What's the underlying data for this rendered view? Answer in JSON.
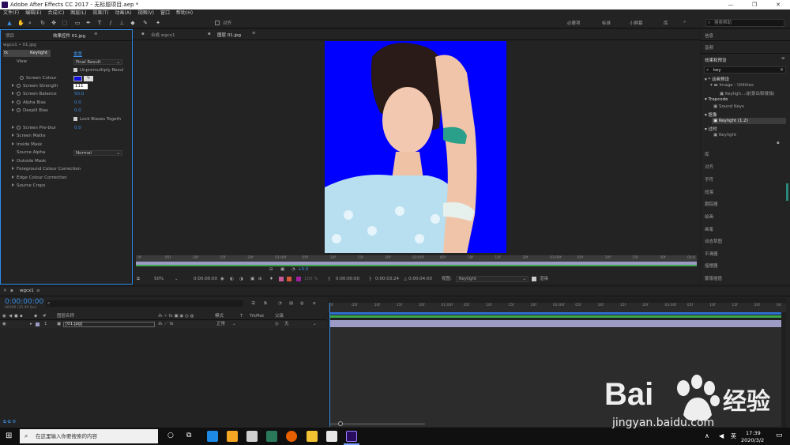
{
  "window": {
    "title": "Adobe After Effects CC 2017 - 无标题项目.aep *"
  },
  "menu": [
    "文件(F)",
    "编辑(E)",
    "合成(C)",
    "图层(L)",
    "效果(T)",
    "动画(A)",
    "视图(V)",
    "窗口",
    "帮助(H)"
  ],
  "toolbar": {
    "align_label": "对齐",
    "workspaces": [
      "必要项",
      "标准",
      "小屏幕",
      "库"
    ],
    "search_placeholder": "搜索帮助"
  },
  "effects_panel": {
    "tabs": [
      "项目",
      "效果控件 01.jpg"
    ],
    "breadcrumb": "wgcx1 • 01.jpg",
    "effect_name": "Keylight",
    "reset_label": "重置",
    "rows": [
      {
        "label": "View",
        "value": "Final Result"
      },
      {
        "label": "Unpremultiply Resul"
      },
      {
        "label": "Screen Colour"
      },
      {
        "label": "Screen Strength",
        "value": "111"
      },
      {
        "label": "Screen Balance",
        "value": "50.0"
      },
      {
        "label": "Alpha Bias",
        "value": "0.0"
      },
      {
        "label": "Despill Bias",
        "value": "0.0"
      },
      {
        "label": "Lock Biases Togeth"
      },
      {
        "label": "Screen Pre-blur",
        "value": "0.0"
      },
      {
        "label": "Screen Matte"
      },
      {
        "label": "Inside Mask"
      },
      {
        "label": "Source Alpha",
        "value": "Normal"
      },
      {
        "label": "Outside Mask"
      },
      {
        "label": "Foreground Colour Correction"
      },
      {
        "label": "Edge Colour Correction"
      },
      {
        "label": "Source Crops"
      }
    ],
    "screen_colour": "#1010e0"
  },
  "comp_panel": {
    "tabs": [
      "合成 wgcx1",
      "图层 01.jpg"
    ],
    "ruler_ticks": [
      "0f",
      "05f",
      "10f",
      "15f",
      "20f",
      "01:00f",
      "05f",
      "10f",
      "15f",
      "20f",
      "02:00f",
      "05f",
      "10f",
      "15f",
      "20f",
      "03:00f",
      "05f",
      "10f",
      "15f",
      "20f",
      "04:0"
    ],
    "zoom": "50%",
    "time1": "0:00:00:00",
    "ratio": "100 %",
    "start": "0:00:00:00",
    "end": "0:00:03:24",
    "duration": "△ 0:00:04:00",
    "view_label": "视图:",
    "view_value": "Keylight",
    "render_label": "渲染",
    "plus": "+0.0",
    "bg_color": "#0000ff"
  },
  "right_panel": {
    "top_items": [
      "信息",
      "音频"
    ],
    "effects_title": "效果和预设",
    "search_value": "key",
    "tree": [
      {
        "label": "* 动画预设",
        "level": 0
      },
      {
        "label": "Image - Utilities",
        "level": 1
      },
      {
        "label": "Keyligh...(前景出和侵蚀)",
        "level": 2
      },
      {
        "label": "Trapcode",
        "level": 0
      },
      {
        "label": "Sound Keys",
        "level": 1
      },
      {
        "label": "抠像",
        "level": 0
      },
      {
        "label": "Keylight (1.2)",
        "level": 1,
        "selected": true
      },
      {
        "label": "过时",
        "level": 0
      },
      {
        "label": "Keylight",
        "level": 1
      }
    ],
    "bottom_items": [
      "库",
      "对齐",
      "字符",
      "段落",
      "跟踪器",
      "绘画",
      "画笔",
      "动态草图",
      "平滑器",
      "摇摆器",
      "蒙版插值"
    ]
  },
  "timeline": {
    "tab": "wgcx1",
    "timecode": "0:00:00:00",
    "fps": "00000 (25.00 fps)",
    "columns": {
      "layer_name": "图层名称",
      "mode": "模式",
      "t": "T",
      "trkmat": "TrkMat",
      "parent": "父级"
    },
    "layers": [
      {
        "num": "1",
        "name": "[01.jpg]",
        "mode": "正常",
        "parent": "无"
      }
    ],
    "ruler_ticks": [
      "0f",
      "05f",
      "10f",
      "15f",
      "20f",
      "01:00f",
      "05f",
      "10f",
      "15f",
      "20f",
      "02:00f",
      "05f",
      "10f",
      "15f",
      "20f",
      "03:00f",
      "05f",
      "10f",
      "15f",
      "20f",
      "04"
    ],
    "bar_color": "#9b9bc5"
  },
  "taskbar": {
    "search_placeholder": "在这里输入你要搜索的内容",
    "time": "17:39",
    "date": "2020/3/2",
    "lang": "英"
  },
  "watermark": {
    "brand": "Bai",
    "cn": "经验",
    "url": "jingyan.baidu.com"
  }
}
